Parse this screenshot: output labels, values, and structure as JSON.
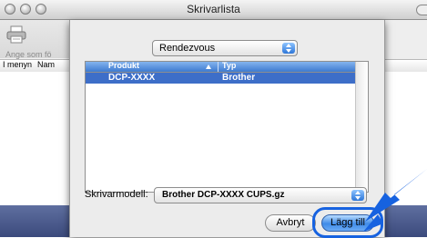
{
  "window": {
    "title": "Skrivarlista",
    "toolbar_label": "Ange som fö",
    "columns": [
      "I menyn",
      "Nam"
    ]
  },
  "sheet": {
    "connection_popup": "Rendezvous",
    "table": {
      "headers": [
        "Produkt",
        "Typ"
      ],
      "rows": [
        {
          "product": "DCP-XXXX",
          "type": "Brother"
        }
      ]
    },
    "model_label": "Skrivarmodell:",
    "model_value": "Brother DCP-XXXX CUPS.gz",
    "cancel_label": "Avbryt",
    "add_label": "Lägg till"
  },
  "colors": {
    "accent": "#1662e0",
    "selection": "#3d6ec8",
    "header_blue": "#5c95e0"
  },
  "icons": {
    "toolbar": "printer-icon",
    "annotation": "pointer-arrow-icon"
  }
}
